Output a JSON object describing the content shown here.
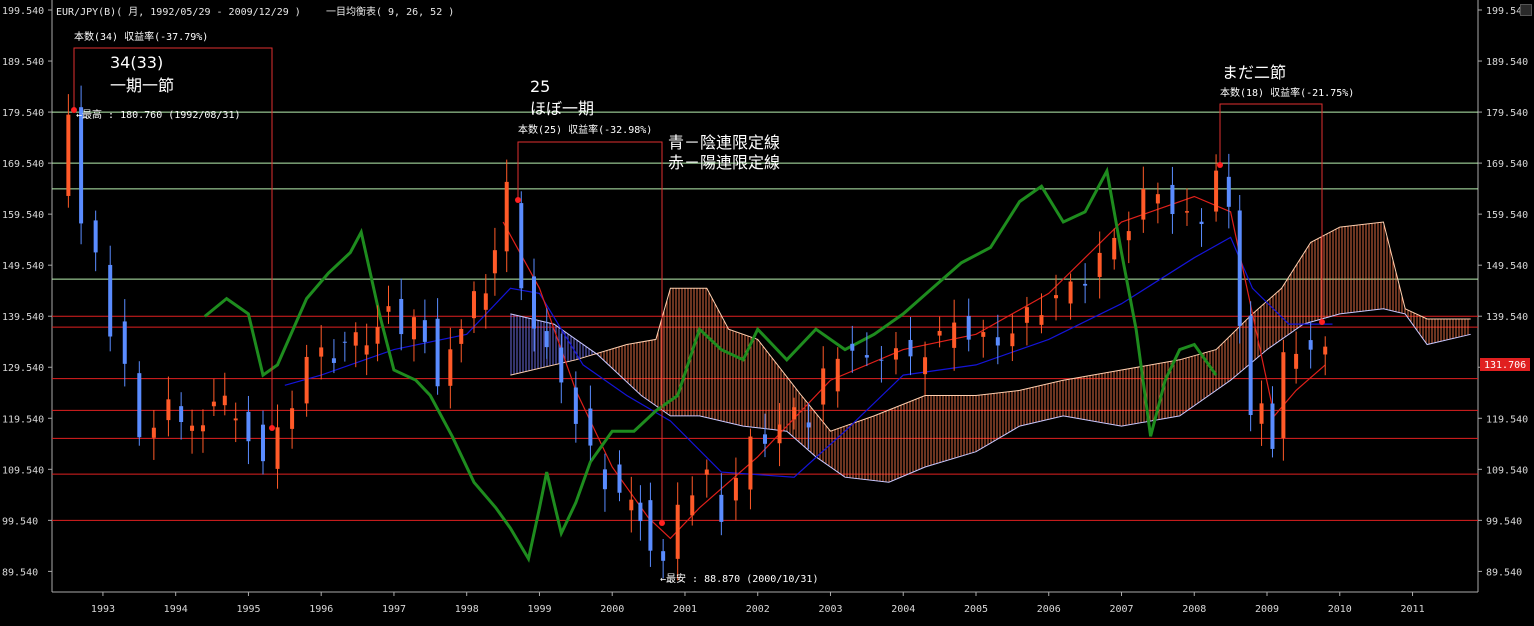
{
  "header": {
    "symbol_line": "EUR/JPY(B)( 月, 1992/05/29 - 2009/12/29 )",
    "indicator_line": "一目均衡表( 9, 26, 52 )"
  },
  "colors": {
    "background": "#000000",
    "bull_candle": "#ff5a28",
    "bear_candle": "#5a8cff",
    "tenkan": "#e0201a",
    "kijun": "#1414d8",
    "chikou": "#1e8c1e",
    "cloud_bull": "#ff7a4a",
    "cloud_bear": "#7a7aff",
    "green_hline": "#b8f0b0",
    "red_hline": "#e02020",
    "annotation_line": "#e03030",
    "current_price_badge": "#e02020"
  },
  "annotations": {
    "a1_count": "34(33)",
    "a1_label": "一期一節",
    "a1_stat": "本数(34) 収益率(-37.79%)",
    "high_label": "←最高 : 180.760 (1992/08/31)",
    "a2_count": "25",
    "a2_label": "ほぼ一期",
    "a2_stat": "本数(25) 収益率(-32.98%)",
    "legend_blue": "青－陰連限定線",
    "legend_red": "赤－陽連限定線",
    "low_label": "←最安 : 88.870 (2000/10/31)",
    "a3_label": "まだ二節",
    "a3_stat": "本数(18) 収益率(-21.75%)"
  },
  "current_price": "131.706",
  "chart_data": {
    "type": "candlestick",
    "x_unit": "year",
    "xlim": [
      1992.3,
      2011.9
    ],
    "y_ticks": [
      "199.540",
      "189.540",
      "179.540",
      "169.540",
      "159.540",
      "149.540",
      "139.540",
      "129.540",
      "119.540",
      "109.540",
      "99.540",
      "89.540"
    ],
    "ylim": [
      85.5,
      201.5
    ],
    "x_ticks": [
      "1993",
      "1994",
      "1995",
      "1996",
      "1997",
      "1998",
      "1999",
      "2000",
      "2001",
      "2002",
      "2003",
      "2004",
      "2005",
      "2006",
      "2007",
      "2008",
      "2009",
      "2010",
      "2011"
    ],
    "horizontal_lines_green": [
      179.54,
      169.54,
      164.5,
      146.8
    ],
    "horizontal_lines_red": [
      139.54,
      137.4,
      127.3,
      121.1,
      115.6,
      108.6,
      99.54
    ],
    "close_series": [
      [
        1992.45,
        163.0
      ],
      [
        1992.6,
        180.7
      ],
      [
        1992.8,
        158.0
      ],
      [
        1993.0,
        150.0
      ],
      [
        1993.2,
        138.0
      ],
      [
        1993.4,
        129.0
      ],
      [
        1993.6,
        115.0
      ],
      [
        1993.8,
        120.0
      ],
      [
        1994.0,
        121.0
      ],
      [
        1994.3,
        118.0
      ],
      [
        1994.6,
        121.0
      ],
      [
        1994.9,
        122.0
      ],
      [
        1995.1,
        117.0
      ],
      [
        1995.3,
        111.0
      ],
      [
        1995.5,
        116.0
      ],
      [
        1995.7,
        124.0
      ],
      [
        1995.9,
        130.0
      ],
      [
        1996.1,
        133.0
      ],
      [
        1996.4,
        132.0
      ],
      [
        1996.7,
        136.0
      ],
      [
        1997.0,
        141.0
      ],
      [
        1997.2,
        137.0
      ],
      [
        1997.5,
        137.0
      ],
      [
        1997.7,
        128.0
      ],
      [
        1998.0,
        137.0
      ],
      [
        1998.2,
        143.0
      ],
      [
        1998.45,
        150.0
      ],
      [
        1998.65,
        164.0
      ],
      [
        1998.85,
        145.0
      ],
      [
        1999.0,
        139.0
      ],
      [
        1999.2,
        131.0
      ],
      [
        1999.4,
        128.0
      ],
      [
        1999.6,
        119.0
      ],
      [
        1999.8,
        112.0
      ],
      [
        2000.0,
        108.0
      ],
      [
        2000.2,
        104.0
      ],
      [
        2000.45,
        101.0
      ],
      [
        2000.6,
        96.0
      ],
      [
        2000.8,
        89.5
      ],
      [
        2001.0,
        103.0
      ],
      [
        2001.2,
        106.0
      ],
      [
        2001.4,
        107.0
      ],
      [
        2001.6,
        101.0
      ],
      [
        2001.8,
        108.0
      ],
      [
        2002.0,
        114.0
      ],
      [
        2002.2,
        117.0
      ],
      [
        2002.4,
        117.0
      ],
      [
        2002.6,
        121.0
      ],
      [
        2002.8,
        120.0
      ],
      [
        2003.0,
        127.0
      ],
      [
        2003.2,
        132.0
      ],
      [
        2003.4,
        134.0
      ],
      [
        2003.6,
        129.0
      ],
      [
        2003.8,
        133.0
      ],
      [
        2004.0,
        133.0
      ],
      [
        2004.2,
        130.0
      ],
      [
        2004.4,
        134.0
      ],
      [
        2004.6,
        135.0
      ],
      [
        2004.8,
        138.0
      ],
      [
        2005.0,
        137.0
      ],
      [
        2005.2,
        134.0
      ],
      [
        2005.4,
        135.0
      ],
      [
        2005.6,
        137.0
      ],
      [
        2005.8,
        139.0
      ],
      [
        2006.0,
        142.0
      ],
      [
        2006.2,
        143.0
      ],
      [
        2006.4,
        145.0
      ],
      [
        2006.6,
        148.0
      ],
      [
        2006.8,
        150.0
      ],
      [
        2007.0,
        155.0
      ],
      [
        2007.2,
        158.0
      ],
      [
        2007.4,
        162.0
      ],
      [
        2007.6,
        165.0
      ],
      [
        2007.8,
        160.0
      ],
      [
        2008.0,
        158.0
      ],
      [
        2008.2,
        160.0
      ],
      [
        2008.4,
        167.0
      ],
      [
        2008.55,
        160.0
      ],
      [
        2008.7,
        140.0
      ],
      [
        2008.85,
        118.0
      ],
      [
        2009.0,
        123.0
      ],
      [
        2009.15,
        115.0
      ],
      [
        2009.3,
        130.0
      ],
      [
        2009.5,
        134.0
      ],
      [
        2009.7,
        133.0
      ],
      [
        2009.9,
        131.7
      ]
    ],
    "tenkan_series": [
      [
        1998.5,
        158
      ],
      [
        1999,
        145
      ],
      [
        1999.5,
        125
      ],
      [
        2000,
        110
      ],
      [
        2000.5,
        100
      ],
      [
        2000.8,
        96
      ],
      [
        2001.2,
        102
      ],
      [
        2002,
        112
      ],
      [
        2003,
        127
      ],
      [
        2004,
        133
      ],
      [
        2005,
        136
      ],
      [
        2006,
        144
      ],
      [
        2007,
        158
      ],
      [
        2008,
        163
      ],
      [
        2008.5,
        160
      ],
      [
        2008.8,
        140
      ],
      [
        2009.1,
        120
      ],
      [
        2009.4,
        125
      ],
      [
        2009.8,
        130
      ]
    ],
    "kijun_series": [
      [
        1995.5,
        126
      ],
      [
        1996,
        128
      ],
      [
        1997,
        133
      ],
      [
        1998,
        136
      ],
      [
        1998.6,
        145
      ],
      [
        1999,
        144
      ],
      [
        1999.6,
        130
      ],
      [
        2000.2,
        124
      ],
      [
        2000.8,
        119
      ],
      [
        2001.5,
        109
      ],
      [
        2002.5,
        108
      ],
      [
        2003.2,
        117
      ],
      [
        2004,
        128
      ],
      [
        2005,
        130
      ],
      [
        2006,
        135
      ],
      [
        2007,
        142
      ],
      [
        2008,
        151
      ],
      [
        2008.5,
        155
      ],
      [
        2008.8,
        145
      ],
      [
        2009.3,
        138
      ],
      [
        2009.9,
        138
      ]
    ],
    "chikou_series": [
      [
        1994.4,
        139.5
      ],
      [
        1994.7,
        143
      ],
      [
        1995.0,
        140
      ],
      [
        1995.2,
        128
      ],
      [
        1995.4,
        130
      ],
      [
        1995.8,
        143
      ],
      [
        1996.1,
        148
      ],
      [
        1996.4,
        152
      ],
      [
        1996.55,
        156
      ],
      [
        1996.8,
        140
      ],
      [
        1997.0,
        129
      ],
      [
        1997.3,
        127
      ],
      [
        1997.5,
        124
      ],
      [
        1997.8,
        116
      ],
      [
        1998.1,
        107
      ],
      [
        1998.4,
        102
      ],
      [
        1998.6,
        98
      ],
      [
        1998.85,
        92
      ],
      [
        1999.0,
        102
      ],
      [
        1999.1,
        109
      ],
      [
        1999.3,
        97
      ],
      [
        1999.5,
        103
      ],
      [
        1999.7,
        111
      ],
      [
        2000.0,
        117
      ],
      [
        2000.3,
        117
      ],
      [
        2000.6,
        121
      ],
      [
        2000.9,
        124
      ],
      [
        2001.2,
        137
      ],
      [
        2001.5,
        133
      ],
      [
        2001.8,
        131
      ],
      [
        2002.0,
        137
      ],
      [
        2002.4,
        131
      ],
      [
        2002.8,
        137
      ],
      [
        2003.2,
        133
      ],
      [
        2003.6,
        136
      ],
      [
        2004.0,
        140
      ],
      [
        2004.4,
        145
      ],
      [
        2004.8,
        150
      ],
      [
        2005.2,
        153
      ],
      [
        2005.6,
        162
      ],
      [
        2005.9,
        165
      ],
      [
        2006.2,
        158
      ],
      [
        2006.5,
        160
      ],
      [
        2006.8,
        168
      ],
      [
        2007.0,
        152
      ],
      [
        2007.2,
        137
      ],
      [
        2007.4,
        116
      ],
      [
        2007.6,
        127
      ],
      [
        2007.8,
        133
      ],
      [
        2008.0,
        134
      ],
      [
        2008.3,
        128
      ]
    ],
    "cloud_span_a": [
      [
        1998.6,
        128
      ],
      [
        1999.5,
        131
      ],
      [
        2000.2,
        134
      ],
      [
        2000.6,
        135
      ],
      [
        2000.8,
        145
      ],
      [
        2001.3,
        145
      ],
      [
        2001.6,
        137
      ],
      [
        2002.0,
        135
      ],
      [
        2002.6,
        124
      ],
      [
        2003.0,
        117
      ],
      [
        2003.6,
        120
      ],
      [
        2004.3,
        124
      ],
      [
        2005.0,
        124
      ],
      [
        2005.6,
        125
      ],
      [
        2006.2,
        127
      ],
      [
        2007.0,
        129
      ],
      [
        2007.8,
        131
      ],
      [
        2008.3,
        133
      ],
      [
        2008.8,
        140
      ],
      [
        2009.2,
        145
      ],
      [
        2009.6,
        154
      ],
      [
        2010.0,
        157
      ],
      [
        2010.6,
        158
      ],
      [
        2010.9,
        141
      ],
      [
        2011.2,
        139
      ],
      [
        2011.8,
        139
      ]
    ],
    "cloud_span_b": [
      [
        1998.6,
        140
      ],
      [
        1999.2,
        138
      ],
      [
        1999.8,
        132
      ],
      [
        2000.4,
        124
      ],
      [
        2000.8,
        120
      ],
      [
        2001.2,
        120
      ],
      [
        2001.8,
        118
      ],
      [
        2002.4,
        117
      ],
      [
        2002.8,
        112
      ],
      [
        2003.2,
        108
      ],
      [
        2003.8,
        107
      ],
      [
        2004.3,
        110
      ],
      [
        2005.0,
        113
      ],
      [
        2005.6,
        118
      ],
      [
        2006.2,
        120
      ],
      [
        2007.0,
        118
      ],
      [
        2007.8,
        120
      ],
      [
        2008.5,
        127
      ],
      [
        2009.0,
        133
      ],
      [
        2009.5,
        138
      ],
      [
        2010.0,
        140
      ],
      [
        2010.6,
        141
      ],
      [
        2010.9,
        140
      ],
      [
        2011.2,
        134
      ],
      [
        2011.8,
        136
      ]
    ]
  }
}
